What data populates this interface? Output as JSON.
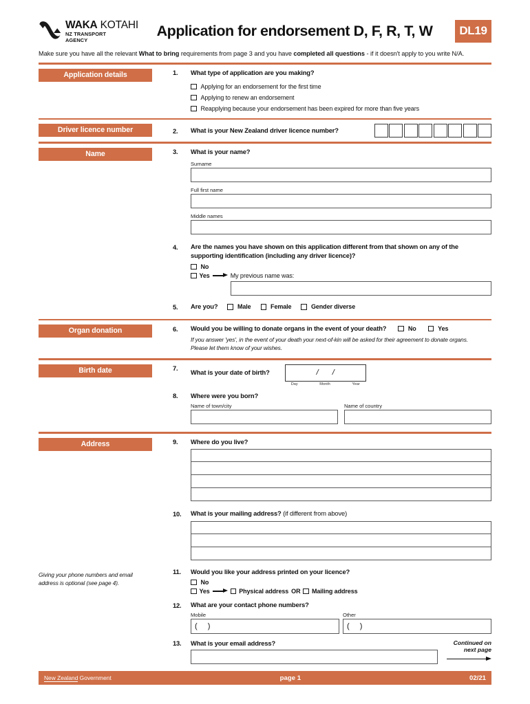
{
  "header": {
    "logo_line1_bold": "WAKA",
    "logo_line1_light": "KOTAHI",
    "logo_line2": "NZ TRANSPORT\nAGENCY",
    "title": "Application for endorsement D, F, R, T, W",
    "badge": "DL19"
  },
  "intro": {
    "part1": "Make sure you have all the relevant ",
    "bold1": "What to bring",
    "part2": " requirements from page 3 and you have ",
    "bold2": "completed all questions",
    "part3": " - if it doesn't apply to you write N/A."
  },
  "sections": {
    "application_details": {
      "label": "Application details",
      "q1": {
        "num": "1.",
        "text": "What type of application are you making?",
        "options": [
          "Applying for an endorsement for the first time",
          "Applying to renew an endorsement",
          "Reapplying because your endorsement has been expired for more than five years"
        ]
      }
    },
    "driver_licence_number": {
      "label": "Driver licence number",
      "q2": {
        "num": "2.",
        "text": "What is your New Zealand driver licence number?",
        "box_count": 8
      }
    },
    "name": {
      "label": "Name",
      "q3": {
        "num": "3.",
        "text": "What is your name?",
        "fields": [
          {
            "label": "Surname",
            "value": ""
          },
          {
            "label": "Full first name",
            "value": ""
          },
          {
            "label": "Middle names",
            "value": ""
          }
        ]
      },
      "q4": {
        "num": "4.",
        "text": "Are the names you have shown on this application different from that shown on any of the supporting identification (including any driver licence)?",
        "no_label": "No",
        "yes_label": "Yes",
        "prev_name_label": "My previous name was:",
        "prev_name_value": ""
      },
      "q5": {
        "num": "5.",
        "text": "Are you?",
        "options": [
          "Male",
          "Female",
          "Gender diverse"
        ]
      }
    },
    "organ_donation": {
      "label": "Organ donation",
      "q6": {
        "num": "6.",
        "text": "Would you be willing to donate organs in the event of your death?",
        "no_label": "No",
        "yes_label": "Yes",
        "note_line1": "If you answer 'yes', in the event of your death your next-of-kin will be asked for their agreement to donate organs.",
        "note_line2": "Please let them know of your wishes."
      }
    },
    "birth_date": {
      "label": "Birth date",
      "q7": {
        "num": "7.",
        "text": "What is your date of birth?",
        "sep": "/",
        "day_label": "Day",
        "month_label": "Month",
        "year_label": "Year"
      },
      "q8": {
        "num": "8.",
        "text": "Where were you born?",
        "town_label": "Name of town/city",
        "town_value": "",
        "country_label": "Name of country",
        "country_value": ""
      }
    },
    "address": {
      "label": "Address",
      "q9": {
        "num": "9.",
        "text": "Where do you live?",
        "line_count": 4
      },
      "q10": {
        "num": "10.",
        "text": "What is your mailing address?",
        "text_reg": " (if different from above)",
        "line_count": 3
      },
      "q11": {
        "num": "11.",
        "text": "Would you like your address printed on your licence?",
        "no_label": "No",
        "yes_label": "Yes",
        "physical_label": "Physical address",
        "or_label": "OR",
        "mailing_label": "Mailing address"
      },
      "q12": {
        "num": "12.",
        "text": "What are your contact phone numbers?",
        "mobile_label": "Mobile",
        "mobile_value": "(      )",
        "other_label": "Other",
        "other_value": "(      )"
      },
      "q13": {
        "num": "13.",
        "text": "What is your email address?",
        "value": ""
      },
      "sidenote": "Giving your phone numbers and email address is optional (see page 4)."
    }
  },
  "continued": {
    "line1": "Continued on",
    "line2": "next page"
  },
  "footer": {
    "left_underlined": "New Zealand",
    "left_rest": " Government",
    "center": "page 1",
    "right": "02/21"
  },
  "colors": {
    "orange": "#cf6e47",
    "field_border": "#58585a"
  }
}
